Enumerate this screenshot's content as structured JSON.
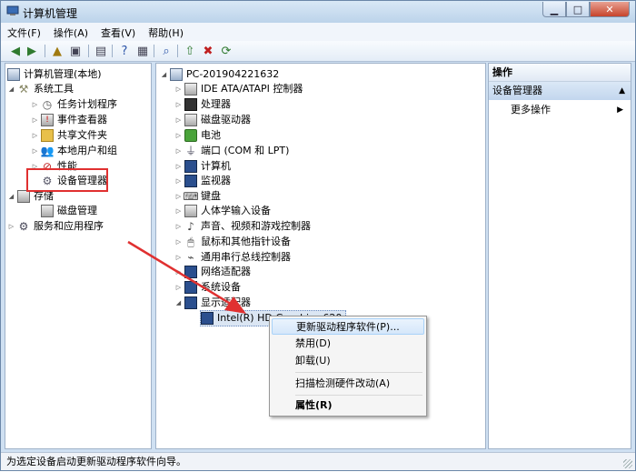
{
  "window": {
    "title": "计算机管理",
    "min": "▁",
    "max": "□",
    "close": "✕"
  },
  "menu": [
    "文件(F)",
    "操作(A)",
    "查看(V)",
    "帮助(H)"
  ],
  "left_tree": {
    "root": "计算机管理(本地)",
    "system_tools": "系统工具",
    "task_scheduler": "任务计划程序",
    "event_viewer": "事件查看器",
    "shared_folders": "共享文件夹",
    "local_users": "本地用户和组",
    "performance": "性能",
    "device_manager": "设备管理器",
    "storage": "存储",
    "disk_management": "磁盘管理",
    "services": "服务和应用程序"
  },
  "device_tree": {
    "computer_name": "PC-201904221632",
    "categories": [
      "IDE ATA/ATAPI 控制器",
      "处理器",
      "磁盘驱动器",
      "电池",
      "端口 (COM 和 LPT)",
      "计算机",
      "监视器",
      "键盘",
      "人体学输入设备",
      "声音、视频和游戏控制器",
      "鼠标和其他指针设备",
      "通用串行总线控制器",
      "网络适配器",
      "系统设备",
      "显示适配器"
    ],
    "selected_device": "Intel(R) HD Graphics 620"
  },
  "actions": {
    "header": "操作",
    "section": "设备管理器",
    "more": "更多操作"
  },
  "context_menu": {
    "update": "更新驱动程序软件(P)...",
    "disable": "禁用(D)",
    "uninstall": "卸载(U)",
    "scan": "扫描检测硬件改动(A)",
    "properties": "属性(R)"
  },
  "status": "为选定设备启动更新驱动程序软件向导。",
  "colors": {
    "highlight_box": "#e03030",
    "arrow": "#e03030"
  }
}
